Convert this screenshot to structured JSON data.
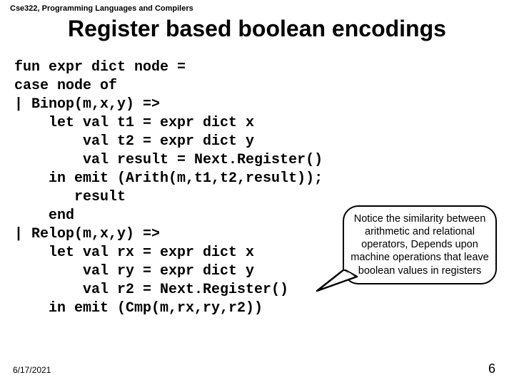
{
  "course_label": "Cse322, Programming Languages and Compilers",
  "title": "Register based boolean encodings",
  "code_lines": [
    "fun expr dict node =",
    "case node of",
    "| Binop(m,x,y) =>",
    "    let val t1 = expr dict x",
    "        val t2 = expr dict y",
    "        val result = Next.Register()",
    "    in emit (Arith(m,t1,t2,result));",
    "       result",
    "    end",
    "| Relop(m,x,y) =>",
    "    let val rx = expr dict x",
    "        val ry = expr dict y",
    "        val r2 = Next.Register()",
    "    in emit (Cmp(m,rx,ry,r2))"
  ],
  "callout_text": "Notice the similarity between arithmetic and relational operators, Depends upon machine operations that leave boolean values in registers",
  "footer": {
    "date": "6/17/2021",
    "page": "6"
  }
}
